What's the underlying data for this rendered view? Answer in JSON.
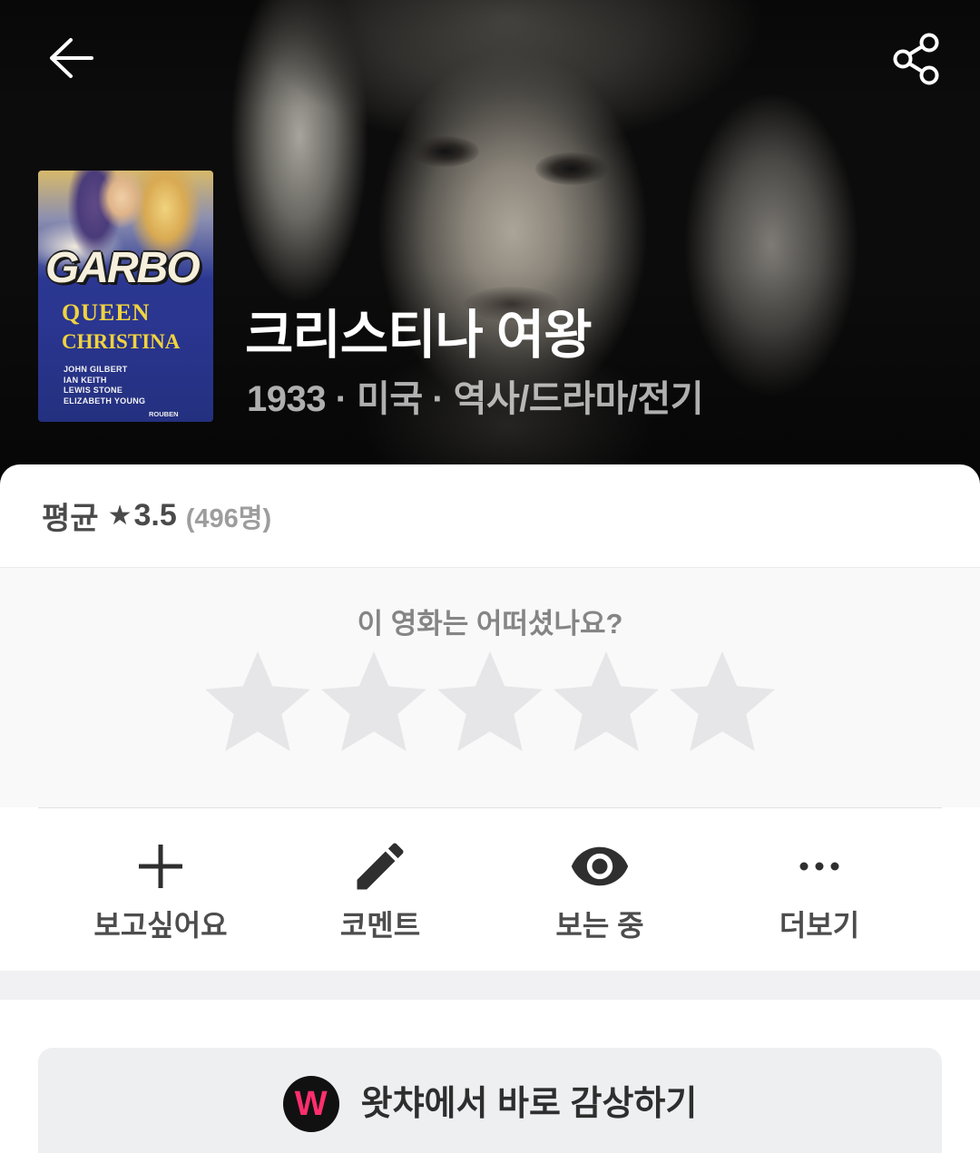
{
  "header": {
    "back_icon": "arrow-left-icon",
    "share_icon": "share-icon"
  },
  "poster": {
    "headline": "GARBO",
    "title_line1": "QUEEN",
    "title_line2": "CHRISTINA",
    "cast": [
      "JOHN GILBERT",
      "IAN KEITH",
      "LEWIS STONE",
      "ELIZABETH YOUNG"
    ],
    "credit": "ROUBEN"
  },
  "movie": {
    "title": "크리스티나 여왕",
    "meta": "1933 · 미국 · 역사/드라마/전기"
  },
  "rating_summary": {
    "label": "평균",
    "star_glyph": "★",
    "average": "3.5",
    "count": "(496명)"
  },
  "rate_prompt": {
    "question": "이 영화는 어떠셨나요?",
    "max_stars": 5,
    "user_rating": 0,
    "star_icon": "star-icon"
  },
  "actions": [
    {
      "label": "보고싶어요",
      "icon": "plus-icon"
    },
    {
      "label": "코멘트",
      "icon": "pencil-icon"
    },
    {
      "label": "보는 중",
      "icon": "eye-icon"
    },
    {
      "label": "더보기",
      "icon": "more-dots-icon"
    }
  ],
  "watch_button": {
    "logo_icon": "watcha-logo-icon",
    "logo_letter": "W",
    "label": "왓챠에서 바로 감상하기"
  },
  "colors": {
    "accent": "#ff2e6d",
    "star_empty": "#e6e6e8",
    "text_primary": "#2f2f2f",
    "text_secondary": "#858585",
    "button_bg": "#eeeff1"
  }
}
